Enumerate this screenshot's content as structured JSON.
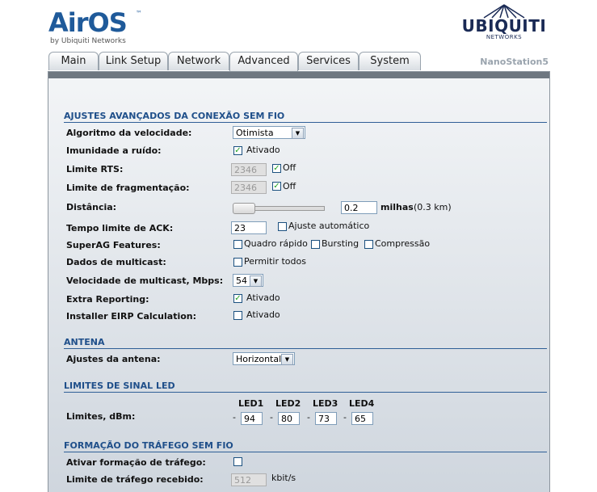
{
  "header": {
    "logo_text": "AirOS",
    "logo_sub": "by Ubiquiti Networks",
    "brand": "UBIQUITI",
    "brand_sub": "NETWORKS",
    "device_name": "NanoStation5"
  },
  "tabs": [
    {
      "label": "Main"
    },
    {
      "label": "Link Setup"
    },
    {
      "label": "Network"
    },
    {
      "label": "Advanced"
    },
    {
      "label": "Services"
    },
    {
      "label": "System"
    }
  ],
  "active_tab": "Advanced",
  "sections": {
    "wireless": {
      "title": "AJUSTES AVANÇADOS DA CONEXÃO SEM FIO",
      "rate_algorithm": {
        "label": "Algoritmo da velocidade:",
        "value": "Otimista"
      },
      "noise_immunity": {
        "label": "Imunidade a ruído:",
        "checked": true,
        "text": "Ativado"
      },
      "rts": {
        "label": "Limite RTS:",
        "value": "2346",
        "off_checked": true,
        "off_text": "Off"
      },
      "frag": {
        "label": "Limite de fragmentação:",
        "value": "2346",
        "off_checked": true,
        "off_text": "Off"
      },
      "distance": {
        "label": "Distância:",
        "value": "0.2",
        "unit": "milhas",
        "km": "(0.3 km)"
      },
      "ack": {
        "label": "Tempo limite de ACK:",
        "value": "23",
        "auto_checked": false,
        "auto_text": "Ajuste automático"
      },
      "superag": {
        "label": "SuperAG Features:",
        "options": [
          {
            "text": "Quadro rápido",
            "checked": false
          },
          {
            "text": "Bursting",
            "checked": false
          },
          {
            "text": "Compressão",
            "checked": false
          }
        ]
      },
      "multicast": {
        "label": "Dados de multicast:",
        "checked": false,
        "text": "Permitir todos"
      },
      "multicast_rate": {
        "label": "Velocidade de multicast, Mbps:",
        "value": "54"
      },
      "extra_reporting": {
        "label": "Extra Reporting:",
        "checked": true,
        "text": "Ativado"
      },
      "eirp": {
        "label": "Installer EIRP Calculation:",
        "checked": false,
        "text": "Ativado"
      }
    },
    "antenna": {
      "title": "ANTENA",
      "setting": {
        "label": "Ajustes da antena:",
        "value": "Horizontal"
      }
    },
    "led": {
      "title": "LIMITES DE SINAL LED",
      "label": "Limites, dBm:",
      "headers": [
        "LED1",
        "LED2",
        "LED3",
        "LED4"
      ],
      "dash": "-",
      "values": [
        "94",
        "80",
        "73",
        "65"
      ]
    },
    "shaping": {
      "title": "FORMAÇÃO DO TRÁFEGO SEM FIO",
      "enable": {
        "label": "Ativar formação de tráfego:",
        "checked": false
      },
      "ingress": {
        "label": "Limite de tráfego recebido:",
        "value": "512",
        "unit": "kbit/s"
      }
    }
  }
}
